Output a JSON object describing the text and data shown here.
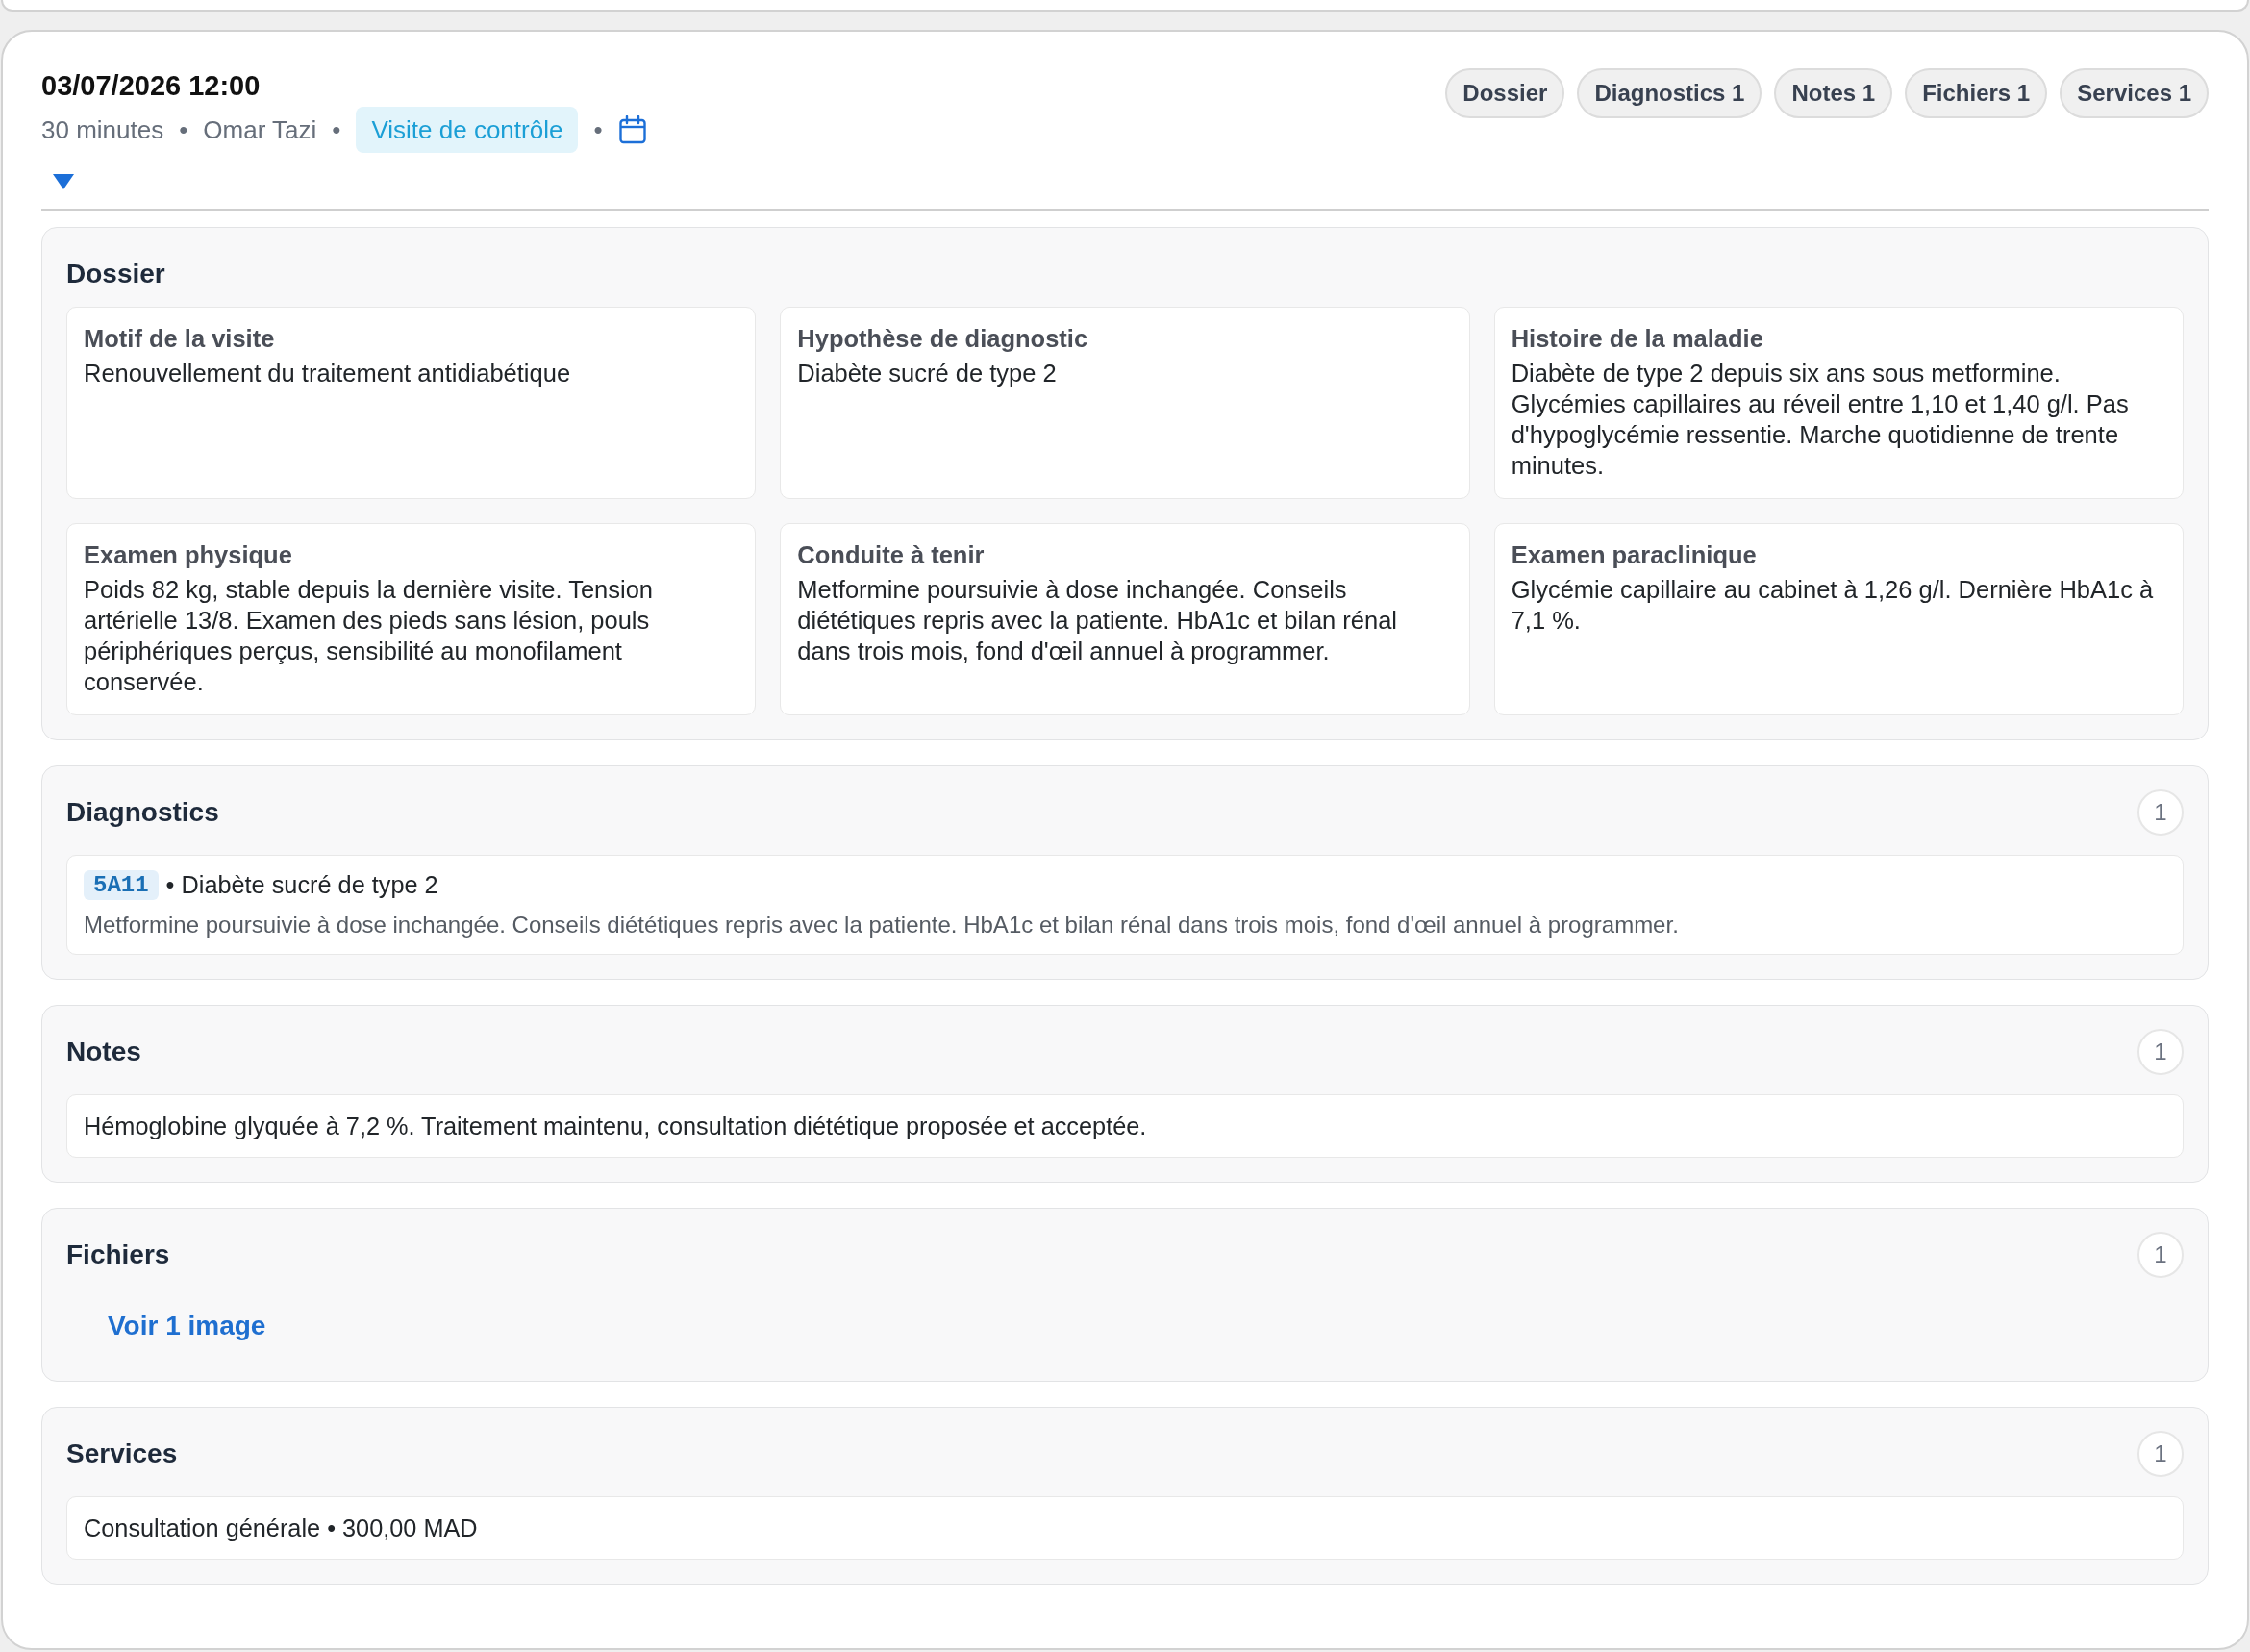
{
  "visit": {
    "datetime": "03/07/2026 12:00",
    "meta": [
      {
        "kind": "text",
        "text": "30 minutes"
      },
      {
        "kind": "separator",
        "text": "•"
      },
      {
        "kind": "text",
        "text": "Omar Tazi"
      },
      {
        "kind": "separator",
        "text": "•"
      },
      {
        "kind": "tag",
        "text": "Visite de contrôle"
      },
      {
        "kind": "separator",
        "text": "•"
      },
      {
        "kind": "calendar"
      }
    ],
    "expanded": true
  },
  "section_tabs": [
    {
      "label": "Dossier"
    },
    {
      "label": "Diagnostics 1"
    },
    {
      "label": "Notes 1"
    },
    {
      "label": "Fichiers 1"
    },
    {
      "label": "Services 1"
    }
  ],
  "sections": [
    {
      "kind": "fields",
      "title": "Dossier",
      "fields": [
        {
          "label": "Motif de la visite",
          "value": "Renouvellement du traitement antidiabétique"
        },
        {
          "label": "Hypothèse de diagnostic",
          "value": "Diabète sucré de type 2"
        },
        {
          "label": "Histoire de la maladie",
          "value": "Diabète de type 2 depuis six ans sous metformine. Glycémies capillaires au réveil entre 1,10 et 1,40 g/l. Pas d'hypoglycémie ressentie. Marche quotidienne de trente minutes."
        },
        {
          "label": "Examen physique",
          "value": "Poids 82 kg, stable depuis la dernière visite. Tension artérielle 13/8. Examen des pieds sans lésion, pouls périphériques perçus, sensibilité au monofilament conservée."
        },
        {
          "label": "Conduite à tenir",
          "value": "Metformine poursuivie à dose inchangée. Conseils diététiques repris avec la patiente. HbA1c et bilan rénal dans trois mois, fond d'œil annuel à programmer."
        },
        {
          "label": "Examen paraclinique",
          "value": "Glycémie capillaire au cabinet à 1,26 g/l. Dernière HbA1c à 7,1 %."
        }
      ]
    },
    {
      "kind": "diagnoses",
      "title": "Diagnostics",
      "count": "1",
      "items": [
        {
          "code": "5A11",
          "label": "• Diabète sucré de type 2",
          "note": "Metformine poursuivie à dose inchangée. Conseils diététiques repris avec la patiente. HbA1c et bilan rénal dans trois mois, fond d'œil annuel à programmer."
        }
      ]
    },
    {
      "kind": "text_items",
      "title": "Notes",
      "count": "1",
      "items": [
        {
          "text": "Hémoglobine glyquée à 7,2 %. Traitement maintenu, consultation diététique proposée et acceptée."
        }
      ]
    },
    {
      "kind": "files",
      "title": "Fichiers",
      "count": "1",
      "link": "Voir 1 image"
    },
    {
      "kind": "text_items",
      "title": "Services",
      "count": "1",
      "items": [
        {
          "text": "Consultation générale • 300,00 MAD"
        }
      ]
    }
  ]
}
